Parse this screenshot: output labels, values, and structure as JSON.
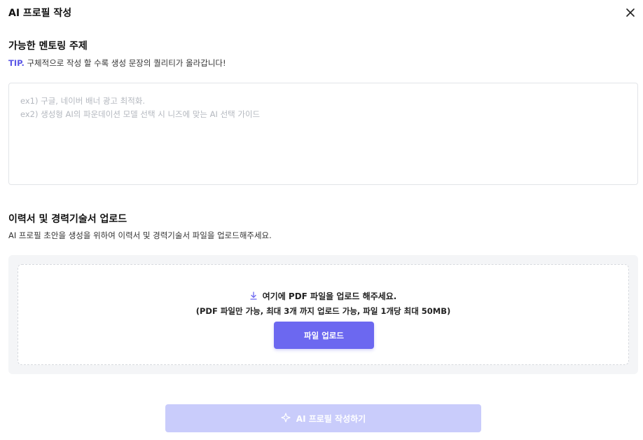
{
  "modal": {
    "title": "AI 프로필 작성",
    "close_icon": "close-icon"
  },
  "topic_section": {
    "title": "가능한 멘토링 주제",
    "tip_label": "TIP.",
    "tip_text": " 구체적으로 작성 할 수록 생성 문장의 퀄리티가 올라갑니다!",
    "textarea_value": "",
    "textarea_placeholder": "ex1) 구글, 네이버 배너 광고 최적화.\nex2) 생성형 AI의 파운데이션 모델 선택 시 니즈에 맞는 AI 선택 가이드"
  },
  "upload_section": {
    "title": "이력서 및 경력기술서 업로드",
    "description": "AI 프로필 초안을 생성을 위하여 이력서 및 경력기술서 파일을 업로드해주세요.",
    "drop_text": "여기에 PDF 파일을 업로드 해주세요.",
    "drop_subtext": "(PDF 파일만 가능, 최대 3개 까지 업로드 가능, 파일 1개당 최대 50MB)",
    "upload_button_label": "파일 업로드",
    "drop_icon": "download-arrow-icon"
  },
  "footer": {
    "generate_button_label": "AI 프로필 작성하기",
    "generate_icon": "sparkle-icon",
    "generate_disabled": true
  },
  "colors": {
    "accent": "#6c68f0",
    "tip": "#5b57e6",
    "disabled_button": "#c9ccfb"
  }
}
